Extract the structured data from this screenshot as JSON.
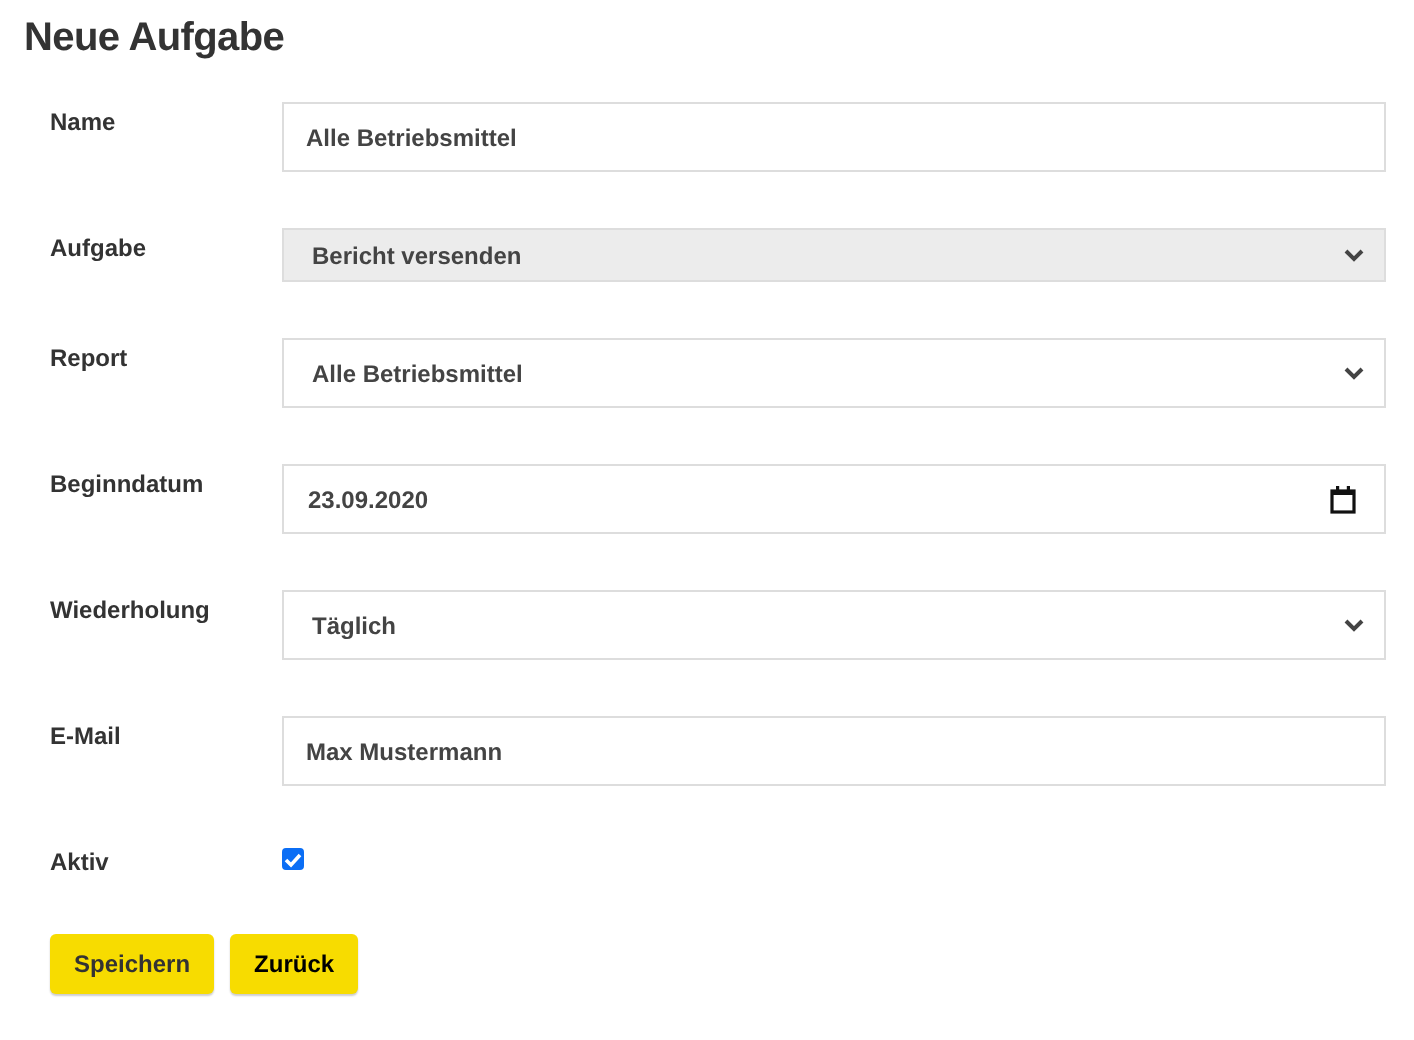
{
  "title": "Neue Aufgabe",
  "fields": [
    {
      "kind": "text",
      "label": "Name",
      "value": "Alle Betriebsmittel"
    },
    {
      "kind": "select",
      "label": "Aufgabe",
      "value": "Bericht versenden",
      "disabled": true
    },
    {
      "kind": "select",
      "label": "Report",
      "value": "Alle Betriebsmittel",
      "disabled": false
    },
    {
      "kind": "date",
      "label": "Beginndatum",
      "value": "23.09.2020"
    },
    {
      "kind": "select",
      "label": "Wiederholung",
      "value": "Täglich",
      "disabled": false
    },
    {
      "kind": "text",
      "label": "E-Mail",
      "value": "Max Mustermann"
    },
    {
      "kind": "checkbox",
      "label": "Aktiv",
      "checked": true
    }
  ],
  "buttons": [
    "Speichern",
    "Zurück"
  ]
}
